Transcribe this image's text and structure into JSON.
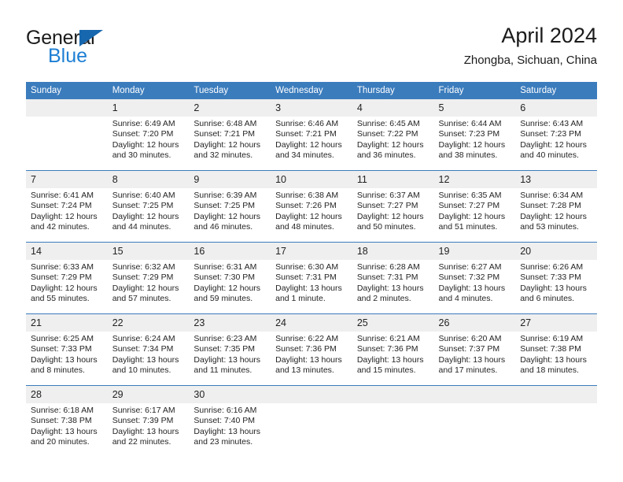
{
  "brand": {
    "word_one": "General",
    "word_two": "Blue",
    "triangle_color": "#1667ae",
    "blue_color": "#1e7fd4"
  },
  "header": {
    "title": "April 2024",
    "subtitle": "Zhongba, Sichuan, China",
    "header_bg": "#3b7cbd",
    "daynum_bg": "#efefef"
  },
  "columns": [
    "Sunday",
    "Monday",
    "Tuesday",
    "Wednesday",
    "Thursday",
    "Friday",
    "Saturday"
  ],
  "labels": {
    "sunrise": "Sunrise:",
    "sunset": "Sunset:",
    "daylight": "Daylight:"
  },
  "weeks": [
    [
      {
        "day": "",
        "sunrise": "",
        "sunset": "",
        "daylight": ""
      },
      {
        "day": "1",
        "sunrise": "Sunrise: 6:49 AM",
        "sunset": "Sunset: 7:20 PM",
        "daylight": "Daylight: 12 hours and 30 minutes."
      },
      {
        "day": "2",
        "sunrise": "Sunrise: 6:48 AM",
        "sunset": "Sunset: 7:21 PM",
        "daylight": "Daylight: 12 hours and 32 minutes."
      },
      {
        "day": "3",
        "sunrise": "Sunrise: 6:46 AM",
        "sunset": "Sunset: 7:21 PM",
        "daylight": "Daylight: 12 hours and 34 minutes."
      },
      {
        "day": "4",
        "sunrise": "Sunrise: 6:45 AM",
        "sunset": "Sunset: 7:22 PM",
        "daylight": "Daylight: 12 hours and 36 minutes."
      },
      {
        "day": "5",
        "sunrise": "Sunrise: 6:44 AM",
        "sunset": "Sunset: 7:23 PM",
        "daylight": "Daylight: 12 hours and 38 minutes."
      },
      {
        "day": "6",
        "sunrise": "Sunrise: 6:43 AM",
        "sunset": "Sunset: 7:23 PM",
        "daylight": "Daylight: 12 hours and 40 minutes."
      }
    ],
    [
      {
        "day": "7",
        "sunrise": "Sunrise: 6:41 AM",
        "sunset": "Sunset: 7:24 PM",
        "daylight": "Daylight: 12 hours and 42 minutes."
      },
      {
        "day": "8",
        "sunrise": "Sunrise: 6:40 AM",
        "sunset": "Sunset: 7:25 PM",
        "daylight": "Daylight: 12 hours and 44 minutes."
      },
      {
        "day": "9",
        "sunrise": "Sunrise: 6:39 AM",
        "sunset": "Sunset: 7:25 PM",
        "daylight": "Daylight: 12 hours and 46 minutes."
      },
      {
        "day": "10",
        "sunrise": "Sunrise: 6:38 AM",
        "sunset": "Sunset: 7:26 PM",
        "daylight": "Daylight: 12 hours and 48 minutes."
      },
      {
        "day": "11",
        "sunrise": "Sunrise: 6:37 AM",
        "sunset": "Sunset: 7:27 PM",
        "daylight": "Daylight: 12 hours and 50 minutes."
      },
      {
        "day": "12",
        "sunrise": "Sunrise: 6:35 AM",
        "sunset": "Sunset: 7:27 PM",
        "daylight": "Daylight: 12 hours and 51 minutes."
      },
      {
        "day": "13",
        "sunrise": "Sunrise: 6:34 AM",
        "sunset": "Sunset: 7:28 PM",
        "daylight": "Daylight: 12 hours and 53 minutes."
      }
    ],
    [
      {
        "day": "14",
        "sunrise": "Sunrise: 6:33 AM",
        "sunset": "Sunset: 7:29 PM",
        "daylight": "Daylight: 12 hours and 55 minutes."
      },
      {
        "day": "15",
        "sunrise": "Sunrise: 6:32 AM",
        "sunset": "Sunset: 7:29 PM",
        "daylight": "Daylight: 12 hours and 57 minutes."
      },
      {
        "day": "16",
        "sunrise": "Sunrise: 6:31 AM",
        "sunset": "Sunset: 7:30 PM",
        "daylight": "Daylight: 12 hours and 59 minutes."
      },
      {
        "day": "17",
        "sunrise": "Sunrise: 6:30 AM",
        "sunset": "Sunset: 7:31 PM",
        "daylight": "Daylight: 13 hours and 1 minute."
      },
      {
        "day": "18",
        "sunrise": "Sunrise: 6:28 AM",
        "sunset": "Sunset: 7:31 PM",
        "daylight": "Daylight: 13 hours and 2 minutes."
      },
      {
        "day": "19",
        "sunrise": "Sunrise: 6:27 AM",
        "sunset": "Sunset: 7:32 PM",
        "daylight": "Daylight: 13 hours and 4 minutes."
      },
      {
        "day": "20",
        "sunrise": "Sunrise: 6:26 AM",
        "sunset": "Sunset: 7:33 PM",
        "daylight": "Daylight: 13 hours and 6 minutes."
      }
    ],
    [
      {
        "day": "21",
        "sunrise": "Sunrise: 6:25 AM",
        "sunset": "Sunset: 7:33 PM",
        "daylight": "Daylight: 13 hours and 8 minutes."
      },
      {
        "day": "22",
        "sunrise": "Sunrise: 6:24 AM",
        "sunset": "Sunset: 7:34 PM",
        "daylight": "Daylight: 13 hours and 10 minutes."
      },
      {
        "day": "23",
        "sunrise": "Sunrise: 6:23 AM",
        "sunset": "Sunset: 7:35 PM",
        "daylight": "Daylight: 13 hours and 11 minutes."
      },
      {
        "day": "24",
        "sunrise": "Sunrise: 6:22 AM",
        "sunset": "Sunset: 7:36 PM",
        "daylight": "Daylight: 13 hours and 13 minutes."
      },
      {
        "day": "25",
        "sunrise": "Sunrise: 6:21 AM",
        "sunset": "Sunset: 7:36 PM",
        "daylight": "Daylight: 13 hours and 15 minutes."
      },
      {
        "day": "26",
        "sunrise": "Sunrise: 6:20 AM",
        "sunset": "Sunset: 7:37 PM",
        "daylight": "Daylight: 13 hours and 17 minutes."
      },
      {
        "day": "27",
        "sunrise": "Sunrise: 6:19 AM",
        "sunset": "Sunset: 7:38 PM",
        "daylight": "Daylight: 13 hours and 18 minutes."
      }
    ],
    [
      {
        "day": "28",
        "sunrise": "Sunrise: 6:18 AM",
        "sunset": "Sunset: 7:38 PM",
        "daylight": "Daylight: 13 hours and 20 minutes."
      },
      {
        "day": "29",
        "sunrise": "Sunrise: 6:17 AM",
        "sunset": "Sunset: 7:39 PM",
        "daylight": "Daylight: 13 hours and 22 minutes."
      },
      {
        "day": "30",
        "sunrise": "Sunrise: 6:16 AM",
        "sunset": "Sunset: 7:40 PM",
        "daylight": "Daylight: 13 hours and 23 minutes."
      },
      {
        "day": "",
        "sunrise": "",
        "sunset": "",
        "daylight": ""
      },
      {
        "day": "",
        "sunrise": "",
        "sunset": "",
        "daylight": ""
      },
      {
        "day": "",
        "sunrise": "",
        "sunset": "",
        "daylight": ""
      },
      {
        "day": "",
        "sunrise": "",
        "sunset": "",
        "daylight": ""
      }
    ]
  ]
}
